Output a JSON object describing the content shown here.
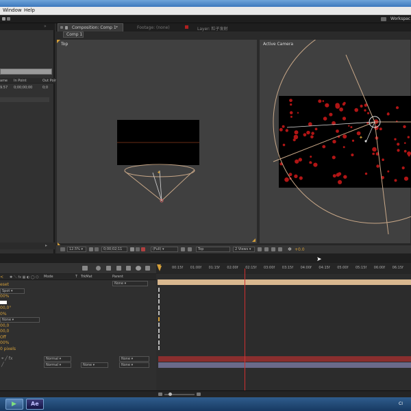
{
  "menu": {
    "window": "Window",
    "help": "Help"
  },
  "toolbar": {
    "workspace": "Workspac"
  },
  "comp_panel": {
    "tab_label": "Composition: Comp 1",
    "footage_tab": "Footage: (none)",
    "layer_tab": "Layer: 粒子发射",
    "subtab": "Comp 1"
  },
  "viewers": {
    "left_label": "Top",
    "right_label": "Active Camera"
  },
  "viewer_toolbar": {
    "zoom": "12.5%",
    "timecode": "0;00;02;11",
    "resolution": "(Full)",
    "view": "Top",
    "layout": "2 Views",
    "exposure": "+0.0"
  },
  "project": {
    "col_name": "ame",
    "col_in": "In Point",
    "col_out": "Out Point",
    "row_in": "0;00;00;00",
    "row_name": "9.57",
    "row_out": "0;0"
  },
  "timeline": {
    "mode_header": "Mode",
    "t_header": "T",
    "trkmat_header": "TrkMat",
    "parent_header": "Parent",
    "ruler": [
      "00:15f",
      "01:00f",
      "01:15f",
      "02:00f",
      "02:15f",
      "03:00f",
      "03:15f",
      "04:00f",
      "04:15f",
      "05:00f",
      "05:15f",
      "06:00f",
      "06:15f"
    ],
    "props": [
      {
        "text": "eset"
      },
      {
        "text": "Spot",
        "dropdown": true
      },
      {
        "text": "00%"
      },
      {
        "text": "",
        "swatch": true
      },
      {
        "text": "00,0°"
      },
      {
        "text": "0%"
      },
      {
        "text": "None",
        "dropdown": true
      },
      {
        "text": "00,0"
      },
      {
        "text": "00,0"
      },
      {
        "text": "Off"
      },
      {
        "text": "00%"
      },
      {
        "text": "0 pixels"
      }
    ],
    "layers": [
      {
        "mode": "Normal",
        "trkmat": "",
        "parent": "None"
      },
      {
        "mode": "Normal",
        "trkmat": "None",
        "parent": "None"
      }
    ],
    "parent_top": "None",
    "playhead_time": "02:15f"
  },
  "taskbar": {
    "ae_label": "Ae",
    "clock": "CI"
  },
  "colors": {
    "accent_orange": "#d5a03a",
    "layer_red": "#8a2e2e",
    "layer_purple": "#6a6a8a",
    "work_area": "#d9b88f"
  }
}
